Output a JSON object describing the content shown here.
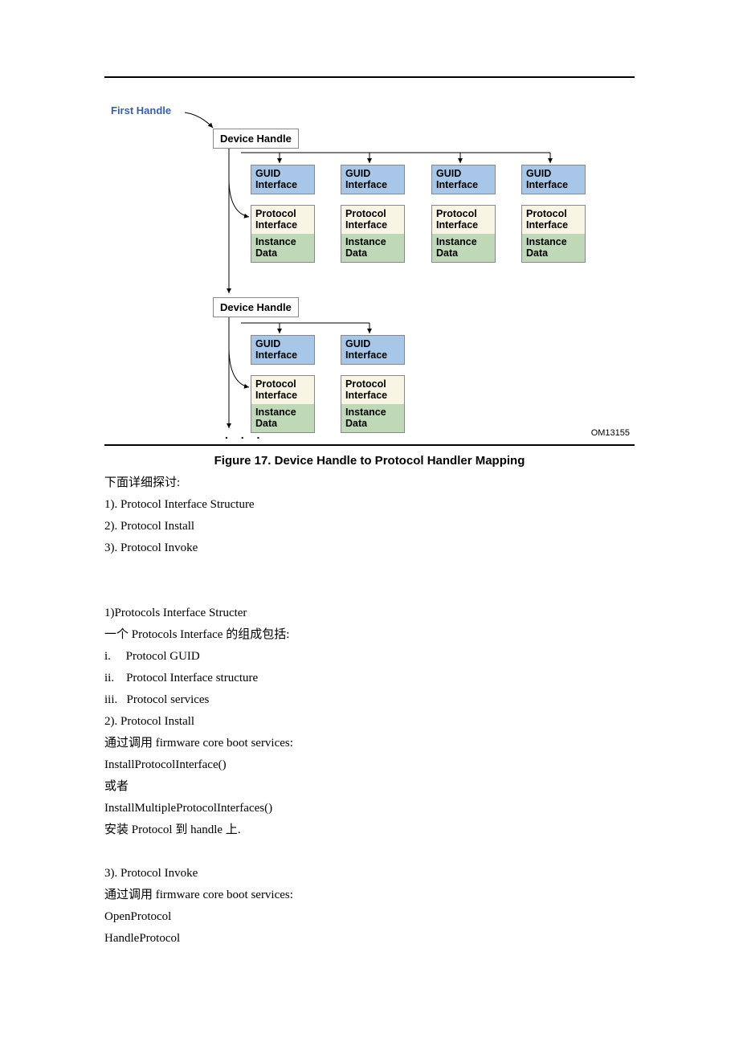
{
  "diagram": {
    "first_handle": "First Handle",
    "device_handle": "Device Handle",
    "guid_interface": "GUID Interface",
    "protocol_interface": "Protocol Interface",
    "instance_data": "Instance Data",
    "om_code": "OM13155",
    "dots": ". . ."
  },
  "caption": "Figure 17. Device Handle to Protocol Handler Mapping",
  "body": {
    "l1": "下面详细探讨:",
    "l2": "1). Protocol Interface Structure",
    "l3": "2). Protocol Install",
    "l4": "3). Protocol Invoke",
    "l5": "1)Protocols Interface Structer",
    "l6": "一个 Protocols Interface 的组成包括:",
    "l7": "i.  Protocol GUID",
    "l8": "ii. Protocol Interface structure",
    "l9": "iii.  Protocol services",
    "l10": "2). Protocol Install",
    "l11": "通过调用 firmware core boot services:",
    "l12": "InstallProtocolInterface()",
    "l13": "或者",
    "l14": "InstallMultipleProtocolInterfaces()",
    "l15": "安装 Protocol 到 handle 上.",
    "l16": "3). Protocol Invoke",
    "l17": "通过调用 firmware core boot services:",
    "l18": "OpenProtocol",
    "l19": "HandleProtocol"
  }
}
